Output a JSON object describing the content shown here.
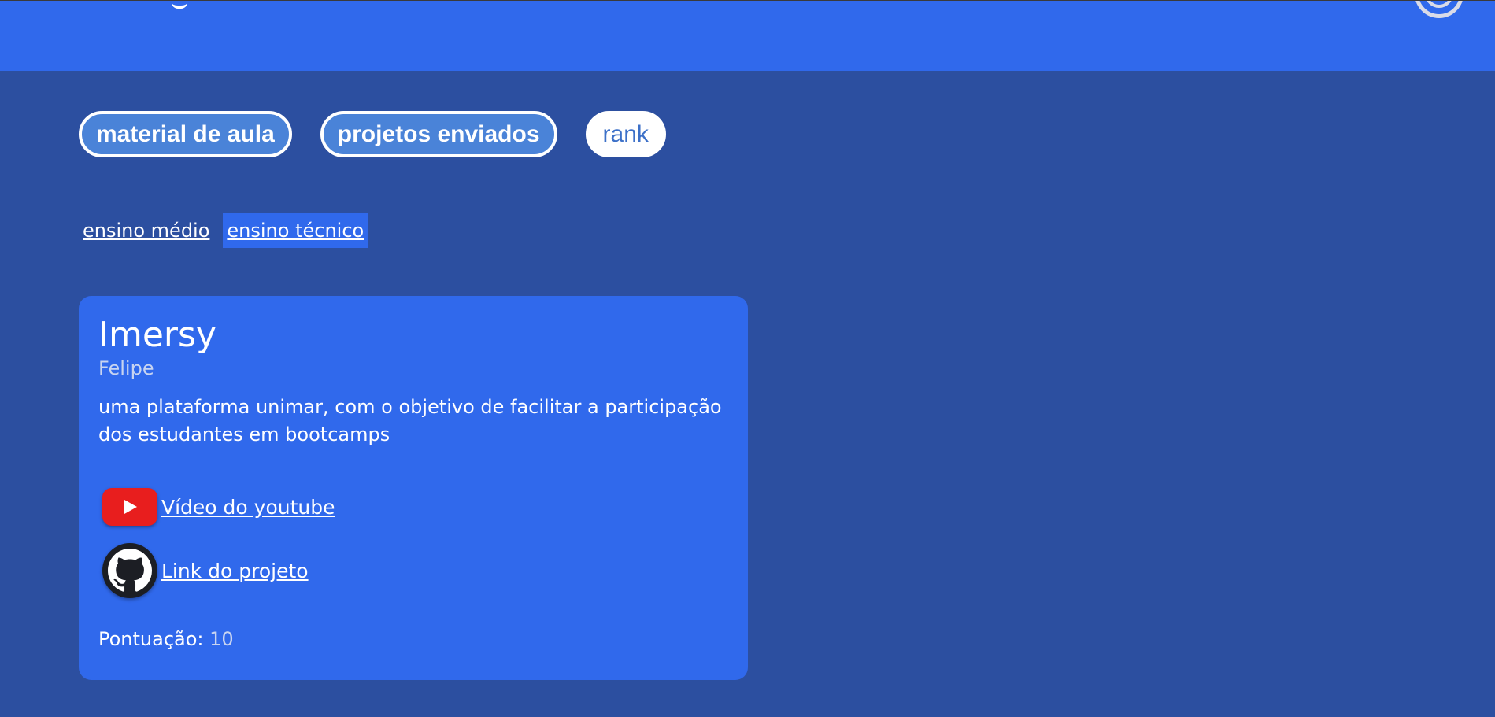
{
  "header": {
    "logo_icon": "logo-icon",
    "avatar_icon": "user-avatar-icon",
    "color": "#3069ec"
  },
  "nav": {
    "tabs": [
      {
        "label": "material de aula",
        "style": "outline"
      },
      {
        "label": "projetos enviados",
        "style": "outline"
      },
      {
        "label": "rank",
        "style": "solid"
      }
    ]
  },
  "sub_tabs": [
    {
      "label": "ensino médio",
      "active": false
    },
    {
      "label": "ensino técnico",
      "active": true
    }
  ],
  "project_card": {
    "title": "Imersy",
    "author": "Felipe",
    "description": "uma plataforma unimar, com o objetivo de facilitar a participação dos estudantes em bootcamps",
    "links": [
      {
        "label": "Vídeo do youtube",
        "icon": "youtube-icon"
      },
      {
        "label": "Link do projeto",
        "icon": "github-icon"
      }
    ],
    "score_label": "Pontuação:",
    "score_value": "10"
  },
  "colors": {
    "background": "#2c4fa0",
    "accent": "#3069ec",
    "youtube_red": "#e81e1e"
  }
}
